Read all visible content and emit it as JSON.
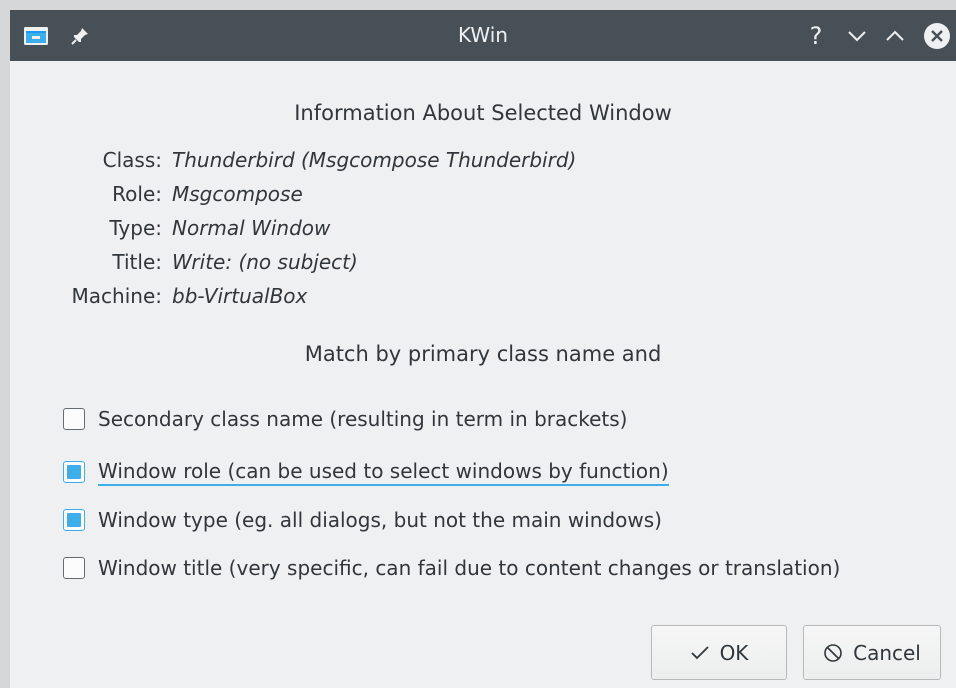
{
  "window": {
    "title": "KWin",
    "app_icon": "window-icon",
    "pin_icon": "pin-icon",
    "help_label": "?",
    "colors": {
      "titlebar": "#475057",
      "background": "#eff0f1",
      "accent": "#3daee9",
      "text": "#31363b"
    }
  },
  "info": {
    "heading": "Information About Selected Window",
    "rows": [
      {
        "key": "Class:",
        "value": "Thunderbird (Msgcompose Thunderbird)"
      },
      {
        "key": "Role:",
        "value": "Msgcompose"
      },
      {
        "key": "Type:",
        "value": "Normal Window"
      },
      {
        "key": "Title:",
        "value": "Write: (no subject)"
      },
      {
        "key": "Machine:",
        "value": "bb-VirtualBox"
      }
    ]
  },
  "match": {
    "heading": "Match by primary class name and",
    "options": [
      {
        "label": "Secondary class name  (resulting in term in brackets)",
        "checked": false
      },
      {
        "label": "Window role (can be used to select windows by function)",
        "checked": true
      },
      {
        "label": "Window type (eg. all dialogs, but not the main windows)",
        "checked": true
      },
      {
        "label": "Window title (very specific, can fail due to content changes or translation)",
        "checked": false
      }
    ]
  },
  "buttons": {
    "ok": {
      "label": "OK",
      "icon": "checkmark-icon"
    },
    "cancel": {
      "label": "Cancel",
      "icon": "cancel-icon"
    }
  }
}
